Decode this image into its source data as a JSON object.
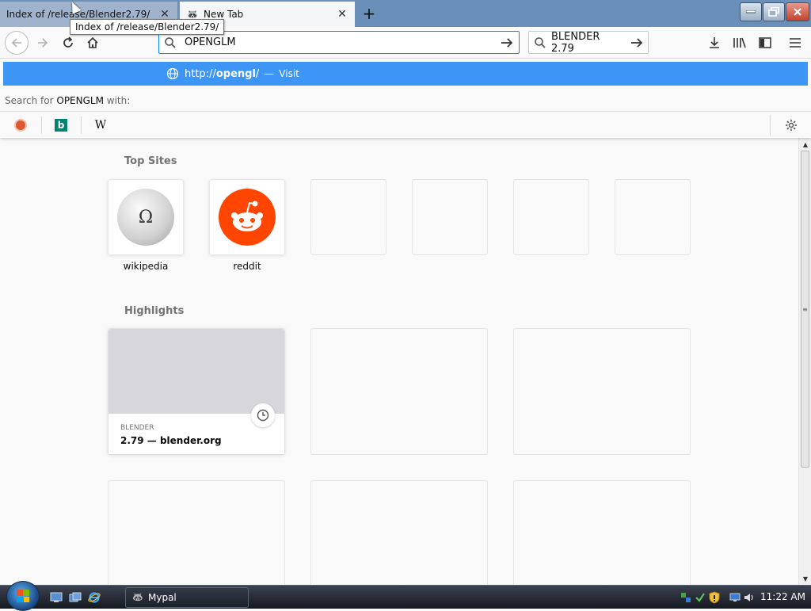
{
  "tabs": [
    {
      "title": "Index of /release/Blender2.79/",
      "close": "✕",
      "active": false
    },
    {
      "title": "New Tab",
      "close": "✕",
      "active": true
    }
  ],
  "tooltip": "Index of /release/Blender2.79/",
  "new_tab_icon": "plus-icon",
  "window_controls": {
    "minimize": "minimize-icon",
    "maximize": "restore-icon",
    "close": "close-icon"
  },
  "nav": {
    "back": "back-arrow-icon",
    "forward": "forward-arrow-icon",
    "reload": "reload-icon",
    "home": "home-icon"
  },
  "urlbar": {
    "value": "OPENGLM",
    "go_icon": "arrow-right-icon"
  },
  "searchbar": {
    "label": "BLENDER 2.79",
    "go_icon": "arrow-right-icon"
  },
  "toolbar_right": [
    "download-icon",
    "library-icon",
    "sidebar-icon",
    "menu-icon"
  ],
  "popup": {
    "suggestion": {
      "prefix": "http://",
      "host": "opengl",
      "suffix": "/",
      "separator": "—",
      "action": "Visit"
    },
    "search_for": {
      "prefix": "Search for",
      "query": "OPENGLM",
      "suffix": "with:"
    },
    "engines": [
      "duckduckgo-icon",
      "bing-icon",
      "wikipedia-icon"
    ],
    "engines_wiki_glyph": "W",
    "engines_bing_glyph": "b"
  },
  "topsites": {
    "title": "Top Sites",
    "sites": [
      {
        "label": "wikipedia",
        "icon": "wikipedia-globe-icon"
      },
      {
        "label": "reddit",
        "icon": "reddit-icon"
      },
      {
        "label": ""
      },
      {
        "label": ""
      },
      {
        "label": ""
      },
      {
        "label": ""
      }
    ]
  },
  "highlights": {
    "title": "Highlights",
    "cards": [
      {
        "source": "BLENDER",
        "title": "2.79 — blender.org",
        "icon": "clock-icon"
      }
    ]
  },
  "taskbar": {
    "app": "Mypal",
    "clock": "11:22 AM",
    "quick_launch": [
      "show-desktop-icon",
      "switch-windows-icon",
      "internet-explorer-icon"
    ]
  },
  "colors": {
    "accent": "#0a84ff",
    "suggestion_bg": "#3d95f5",
    "reddit": "#ff4500",
    "taskbar": "#1c212a"
  }
}
